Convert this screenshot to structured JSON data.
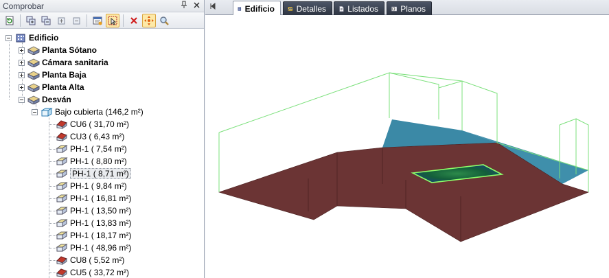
{
  "panel": {
    "title": "Comprobar",
    "pin_icon": "pin-icon",
    "close_icon": "close-icon"
  },
  "toolbar": {
    "buttons": [
      "refresh-icon",
      "expand-all-icon",
      "collapse-all-icon",
      "expand-icon",
      "collapse-icon",
      "properties-icon",
      "select-icon",
      "delete-icon",
      "move-icon",
      "search-icon"
    ],
    "active_buttons": [
      "select-icon",
      "move-icon"
    ]
  },
  "tree": {
    "root": "Edificio",
    "floors": [
      "Planta Sótano",
      "Cámara sanitaria",
      "Planta Baja",
      "Planta Alta",
      "Desván"
    ],
    "zone": "Bajo cubierta (146,2 m²)",
    "items": [
      {
        "type": "CU6",
        "area": "( 31,70 m²)",
        "icon": "roof-element-icon"
      },
      {
        "type": "CU3",
        "area": "( 6,43 m²)",
        "icon": "roof-element-icon"
      },
      {
        "type": "PH-1",
        "area": "( 7,54 m²)",
        "icon": "floor-slab-icon"
      },
      {
        "type": "PH-1",
        "area": "( 8,80 m²)",
        "icon": "floor-slab-icon"
      },
      {
        "type": "PH-1",
        "area": "( 8,71 m²)",
        "icon": "floor-slab-icon",
        "selected": true
      },
      {
        "type": "PH-1",
        "area": "( 9,84 m²)",
        "icon": "floor-slab-icon"
      },
      {
        "type": "PH-1",
        "area": "( 16,81 m²)",
        "icon": "floor-slab-icon"
      },
      {
        "type": "PH-1",
        "area": "( 13,50 m²)",
        "icon": "floor-slab-icon"
      },
      {
        "type": "PH-1",
        "area": "( 13,83 m²)",
        "icon": "floor-slab-icon"
      },
      {
        "type": "PH-1",
        "area": "( 18,17 m²)",
        "icon": "floor-slab-icon"
      },
      {
        "type": "PH-1",
        "area": "( 48,96 m²)",
        "icon": "floor-slab-icon"
      },
      {
        "type": "CU8",
        "area": "( 5,52 m²)",
        "icon": "roof-element-icon"
      },
      {
        "type": "CU5",
        "area": "( 33,72 m²)",
        "icon": "roof-element-icon"
      }
    ]
  },
  "tabs": [
    {
      "label": "Edificio",
      "icon": "building-icon",
      "active": true
    },
    {
      "label": "Detalles",
      "icon": "details-icon",
      "active": false
    },
    {
      "label": "Listados",
      "icon": "document-icon",
      "active": false
    },
    {
      "label": "Planos",
      "icon": "plans-icon",
      "active": false
    }
  ],
  "colors": {
    "floor": "#6b3434",
    "roof": "#3c8aa6",
    "outline": "#7be07b",
    "selection_slab": "#0d5a2a"
  }
}
